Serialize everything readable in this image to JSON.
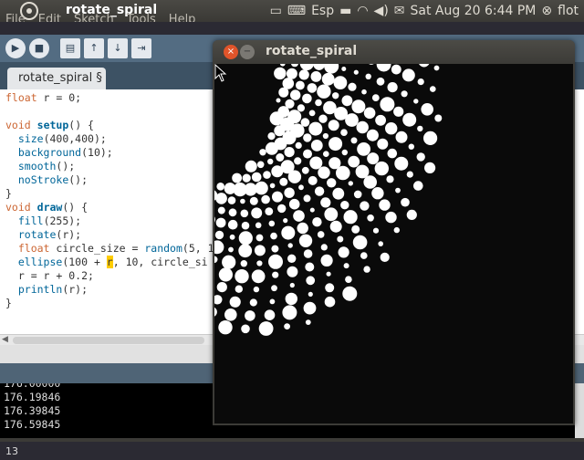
{
  "panel": {
    "app_title": "rotate_spiral",
    "menus": [
      "File",
      "Edit",
      "Sketch",
      "Tools",
      "Help"
    ],
    "keyboard_layout": "Esp",
    "datetime": "Sat Aug 20  6:44 PM",
    "user": "flot"
  },
  "ide": {
    "tab_label": "rotate_spiral §",
    "code_lines": [
      "float r = 0;",
      "",
      "void setup() {",
      "  size(400,400);",
      "  background(10);",
      "  smooth();",
      "  noStroke();",
      "}",
      "void draw() {",
      "  fill(255);",
      "  rotate(r);",
      "  float circle_size = random(5, 1",
      "  ellipse(100 + r, 10, circle_si",
      "  r = r + 0.2;",
      "  println(r);",
      "}"
    ],
    "console_lines": [
      "176.19846",
      "176.39845",
      "176.59845"
    ],
    "line_number": "13"
  },
  "sketch": {
    "title": "rotate_spiral"
  },
  "colors": {
    "panel_bg": "#3c3b37",
    "toolbar_bg": "#536c82",
    "close_button": "#e0542a",
    "keyword": "#cc6633",
    "function": "#006699",
    "highlight": "#ffcc00",
    "canvas_bg": "#0a0a0a"
  }
}
